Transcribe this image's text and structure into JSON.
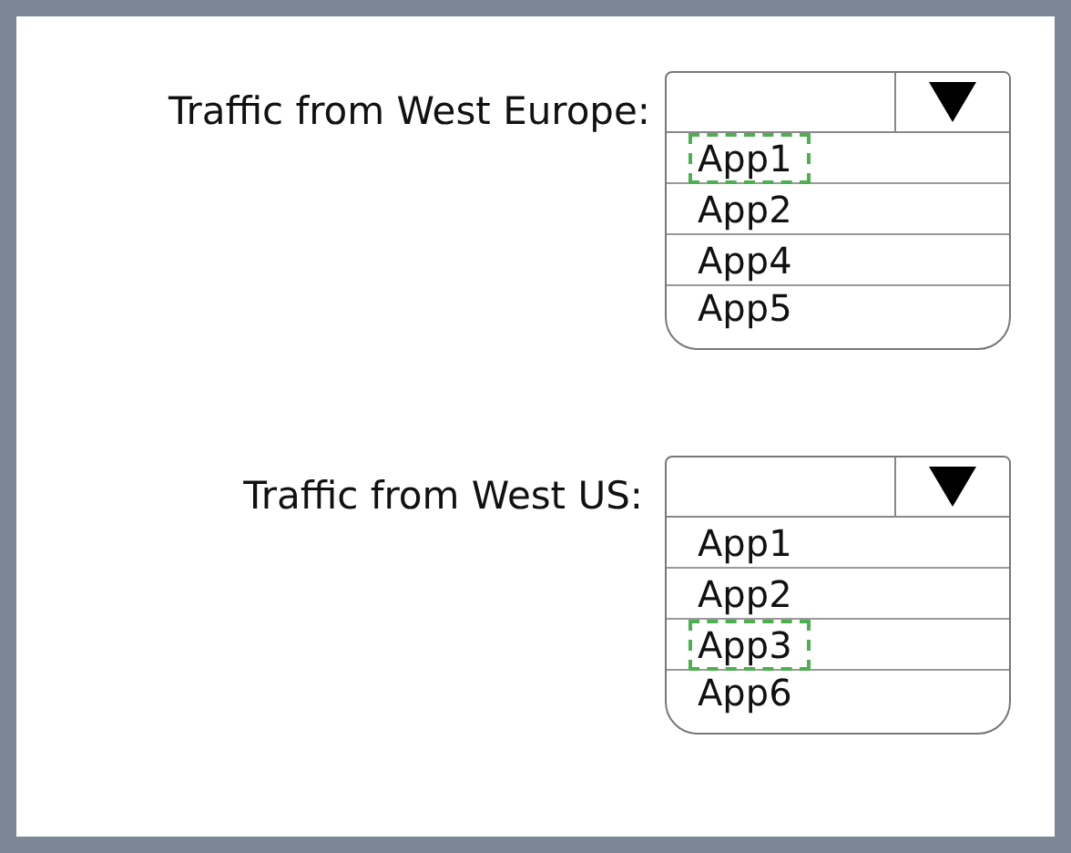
{
  "dropdowns": [
    {
      "label": "Traffic from West Europe:",
      "options": [
        {
          "text": "App1",
          "selected": true
        },
        {
          "text": "App2",
          "selected": false
        },
        {
          "text": "App4",
          "selected": false
        },
        {
          "text": "App5",
          "selected": false
        }
      ]
    },
    {
      "label": "Traffic from West US:",
      "options": [
        {
          "text": "App1",
          "selected": false
        },
        {
          "text": "App2",
          "selected": false
        },
        {
          "text": "App3",
          "selected": true
        },
        {
          "text": "App6",
          "selected": false
        }
      ]
    }
  ]
}
